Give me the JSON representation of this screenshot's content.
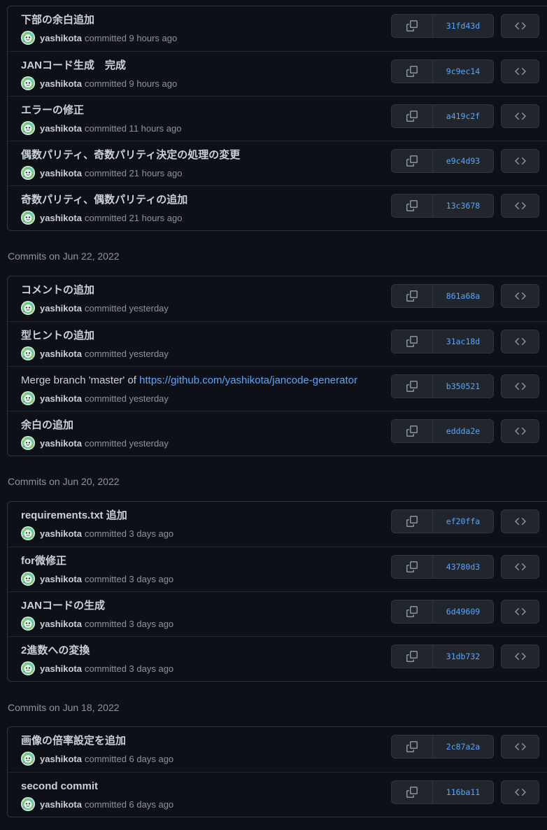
{
  "groups": [
    {
      "header": "",
      "commits": [
        {
          "title": "下部の余白追加",
          "author": "yashikota",
          "time": "committed 9 hours ago",
          "sha": "31fd43d"
        },
        {
          "title": "JANコード生成　完成",
          "author": "yashikota",
          "time": "committed 9 hours ago",
          "sha": "9c9ec14"
        },
        {
          "title": "エラーの修正",
          "author": "yashikota",
          "time": "committed 11 hours ago",
          "sha": "a419c2f"
        },
        {
          "title": "偶数パリティ、奇数パリティ決定の処理の変更",
          "author": "yashikota",
          "time": "committed 21 hours ago",
          "sha": "e9c4d93"
        },
        {
          "title": "奇数パリティ、偶数パリティの追加",
          "author": "yashikota",
          "time": "committed 21 hours ago",
          "sha": "13c3678"
        }
      ]
    },
    {
      "header": "Commits on Jun 22, 2022",
      "commits": [
        {
          "title": "コメントの追加",
          "author": "yashikota",
          "time": "committed yesterday",
          "sha": "861a68a"
        },
        {
          "title": "型ヒントの追加",
          "author": "yashikota",
          "time": "committed yesterday",
          "sha": "31ac18d"
        },
        {
          "title": "Merge branch 'master' of ",
          "link": "https://github.com/yashikota/jancode-generator",
          "author": "yashikota",
          "time": "committed yesterday",
          "sha": "b350521"
        },
        {
          "title": "余白の追加",
          "author": "yashikota",
          "time": "committed yesterday",
          "sha": "eddda2e"
        }
      ]
    },
    {
      "header": "Commits on Jun 20, 2022",
      "commits": [
        {
          "title": "requirements.txt 追加",
          "author": "yashikota",
          "time": "committed 3 days ago",
          "sha": "ef20ffa"
        },
        {
          "title": "for微修正",
          "author": "yashikota",
          "time": "committed 3 days ago",
          "sha": "43780d3"
        },
        {
          "title": "JANコードの生成",
          "author": "yashikota",
          "time": "committed 3 days ago",
          "sha": "6d49609"
        },
        {
          "title": "2進数への変換",
          "author": "yashikota",
          "time": "committed 3 days ago",
          "sha": "31db732"
        }
      ]
    },
    {
      "header": "Commits on Jun 18, 2022",
      "commits": [
        {
          "title": "画像の倍率設定を追加",
          "author": "yashikota",
          "time": "committed 6 days ago",
          "sha": "2c87a2a"
        },
        {
          "title": "second commit",
          "author": "yashikota",
          "time": "committed 6 days ago",
          "sha": "116ba11"
        }
      ]
    }
  ],
  "icons": {
    "copy": "copy-icon",
    "browse": "code-icon"
  },
  "colors": {
    "background": "#0d1117",
    "border": "#30363d",
    "link": "#58a6ff",
    "muted": "#8b949e",
    "text": "#c9d1d9"
  }
}
